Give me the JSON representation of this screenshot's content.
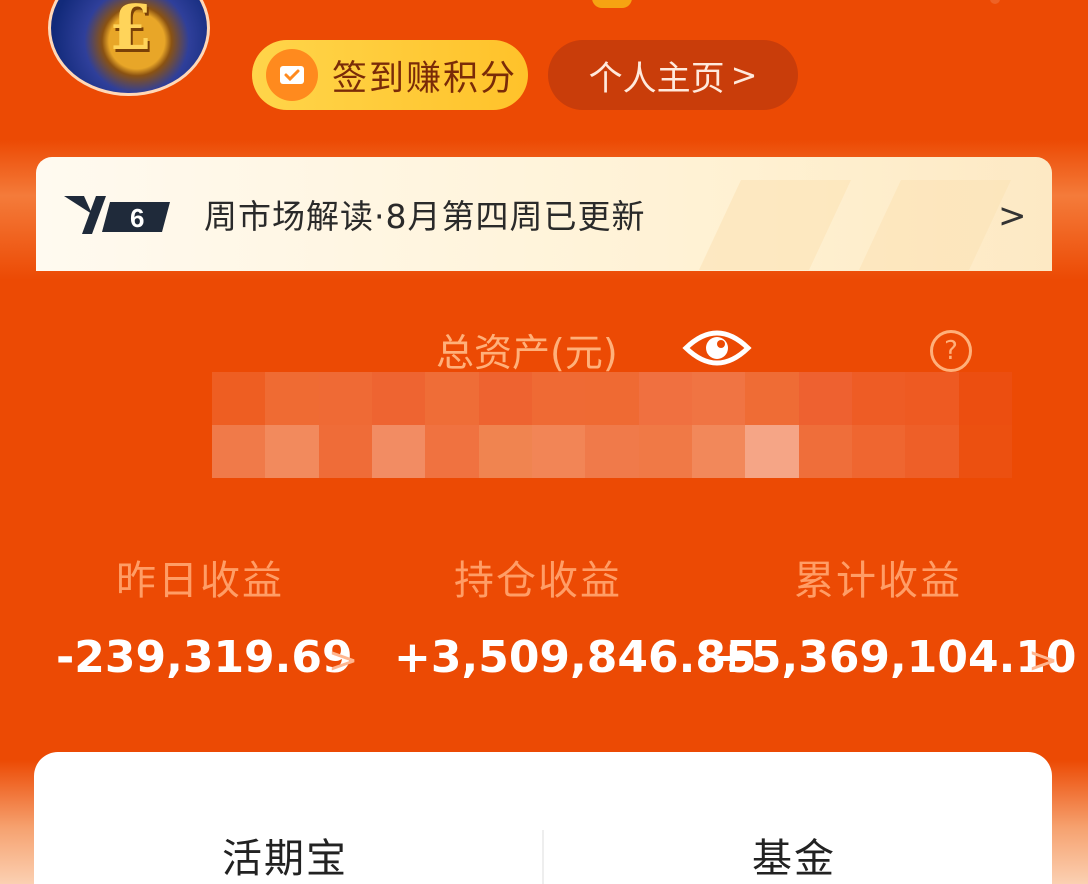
{
  "header": {
    "checkin_label": "签到赚积分",
    "profile_label": "个人主页",
    "profile_chevron": ">"
  },
  "banner": {
    "badge_number": "6",
    "text": "周市场解读·8月第四周已更新",
    "chevron": ">"
  },
  "assets": {
    "title": "总资产(元)",
    "help_symbol": "?"
  },
  "stats": [
    {
      "label": "昨日收益",
      "value": "-239,319.69",
      "chevron": ">"
    },
    {
      "label": "持仓收益",
      "value": "+3,509,846.85"
    },
    {
      "label": "累计收益",
      "value": "+5,369,104.10",
      "chevron": ">"
    }
  ],
  "tabs": [
    {
      "label": "活期宝"
    },
    {
      "label": "基金"
    }
  ],
  "colors": {
    "background": "#ec4a04",
    "checkin_bg": "#ffc22a",
    "profile_bg": "#c93d0a"
  },
  "icons": {
    "eye": "eye-icon",
    "help": "question-circle-icon",
    "checkin": "envelope-check-icon"
  }
}
